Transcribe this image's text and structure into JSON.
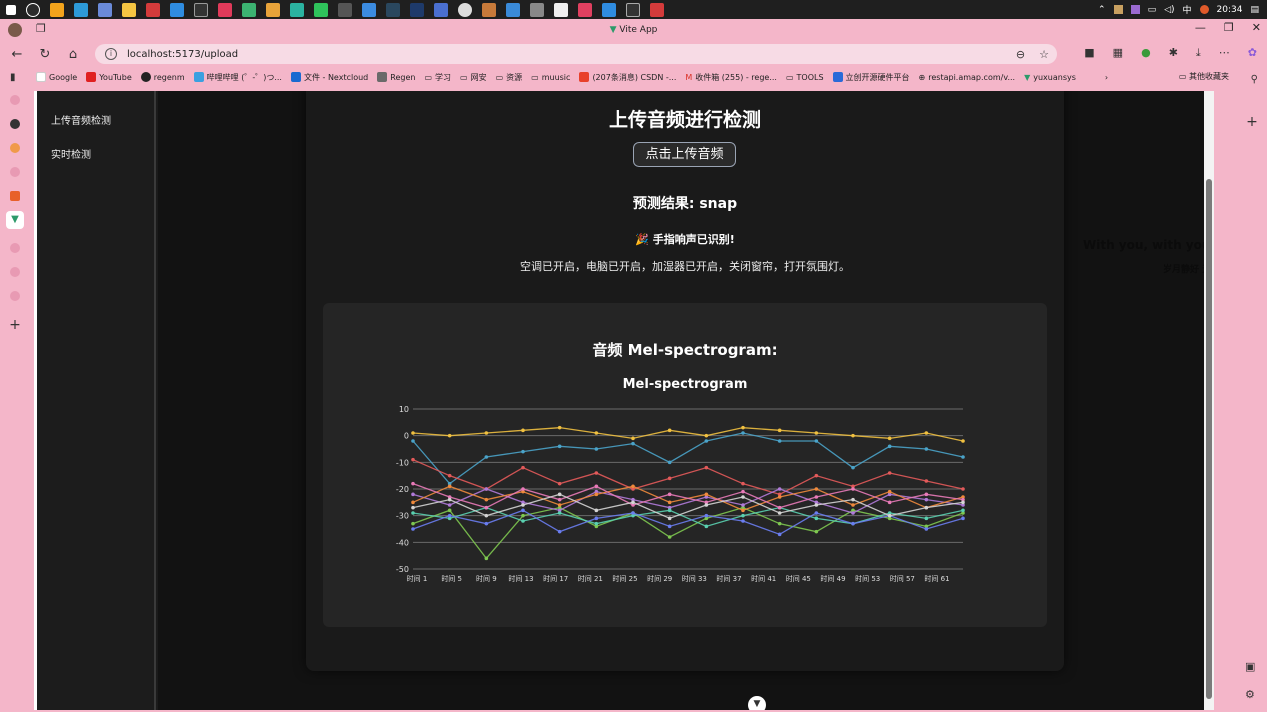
{
  "taskbar": {
    "time": "20:34",
    "lang": "中"
  },
  "window": {
    "title": "Vite App"
  },
  "address": {
    "url": "localhost:5173/upload"
  },
  "bookmarks": [
    "Google",
    "YouTube",
    "regenm",
    "哔哩哔哩 (゜-゜)つ...",
    "文件 - Nextcloud",
    "Regen",
    "学习",
    "网安",
    "资源",
    "muusic",
    "(207条消息) CSDN -...",
    "收件箱 (255) - rege...",
    "TOOLS",
    "立创开源硬件平台",
    "restapi.amap.com/v...",
    "yuxuansys"
  ],
  "bookmarks_other": "其他收藏夹",
  "appnav": {
    "items": [
      "上传音频检测",
      "实时检测"
    ]
  },
  "page": {
    "heading": "上传音频进行检测",
    "upload_label": "点击上传音频",
    "prediction": "预测结果: snap",
    "recognized": "🎉 手指响声已识别!",
    "actions": "空调已开启，电脑已开启，加湿器已开启，关闭窗帘，打开氛围灯。",
    "spectrogram_heading": "音频 Mel-spectrogram:"
  },
  "overlay": {
    "lyric_line1": "With you, with you nobody else here",
    "lyric_line2": "岁月静好 无人叨扰"
  },
  "colors": {
    "accent": "#9aa4b4",
    "background": "#121212",
    "card": "#1a1a1a",
    "chart_bg": "#252525"
  },
  "chart_data": {
    "type": "line",
    "title": "Mel-spectrogram",
    "xlabel": "",
    "ylabel": "",
    "ylim": [
      -50,
      10
    ],
    "yticks": [
      10,
      0,
      -10,
      -20,
      -30,
      -40,
      -50
    ],
    "x_categories": [
      "时间 1",
      "时间 5",
      "时间 9",
      "时间 13",
      "时间 17",
      "时间 21",
      "时间 25",
      "时间 29",
      "时间 33",
      "时间 37",
      "时间 41",
      "时间 45",
      "时间 49",
      "时间 53",
      "时间 57",
      "时间 61"
    ],
    "grid": true,
    "legend": "none",
    "series": [
      {
        "color": "#4aa3c9",
        "values": [
          -2,
          -18,
          -8,
          -6,
          -4,
          -5,
          -3,
          -10,
          -2,
          1,
          -2,
          -2,
          -12,
          -4,
          -5,
          -8
        ]
      },
      {
        "color": "#f0c040",
        "values": [
          1,
          0,
          1,
          2,
          3,
          1,
          -1,
          2,
          0,
          3,
          2,
          1,
          0,
          -1,
          1,
          -2
        ]
      },
      {
        "color": "#e35a5a",
        "values": [
          -9,
          -15,
          -20,
          -12,
          -18,
          -14,
          -20,
          -16,
          -12,
          -18,
          -22,
          -15,
          -19,
          -14,
          -17,
          -20
        ]
      },
      {
        "color": "#7ec850",
        "values": [
          -33,
          -28,
          -46,
          -30,
          -27,
          -34,
          -29,
          -38,
          -31,
          -27,
          -33,
          -36,
          -28,
          -31,
          -34,
          -29
        ]
      },
      {
        "color": "#b07ad9",
        "values": [
          -22,
          -26,
          -20,
          -25,
          -28,
          -21,
          -24,
          -27,
          -23,
          -26,
          -20,
          -25,
          -29,
          -22,
          -24,
          -26
        ]
      },
      {
        "color": "#f08a3c",
        "values": [
          -25,
          -19,
          -24,
          -21,
          -26,
          -22,
          -19,
          -25,
          -22,
          -28,
          -23,
          -20,
          -26,
          -21,
          -27,
          -23
        ]
      },
      {
        "color": "#5ad0b0",
        "values": [
          -29,
          -31,
          -27,
          -32,
          -29,
          -33,
          -30,
          -28,
          -34,
          -30,
          -27,
          -31,
          -33,
          -29,
          -31,
          -28
        ]
      },
      {
        "color": "#e87ab8",
        "values": [
          -18,
          -23,
          -27,
          -20,
          -24,
          -19,
          -26,
          -22,
          -25,
          -21,
          -27,
          -23,
          -20,
          -25,
          -22,
          -24
        ]
      },
      {
        "color": "#6a7df0",
        "values": [
          -35,
          -30,
          -33,
          -28,
          -36,
          -31,
          -29,
          -34,
          -30,
          -32,
          -37,
          -29,
          -33,
          -30,
          -35,
          -31
        ]
      },
      {
        "color": "#d4d4d4",
        "values": [
          -27,
          -24,
          -30,
          -26,
          -22,
          -28,
          -25,
          -31,
          -26,
          -23,
          -29,
          -26,
          -24,
          -30,
          -27,
          -25
        ]
      }
    ]
  }
}
